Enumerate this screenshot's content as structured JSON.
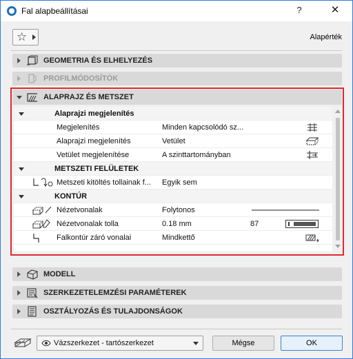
{
  "window": {
    "title": "Fal alapbeállításai",
    "help_label": "?",
    "close_label": "✕"
  },
  "toolbar": {
    "favorites_icon": "star-icon",
    "default_label": "Alapérték"
  },
  "sections": [
    {
      "label": "GEOMETRIA ÉS ELHELYEZÉS",
      "icon": "geometry-icon",
      "enabled": true
    },
    {
      "label": "PROFILMÓDOSÍTÓK",
      "icon": "profile-modifier-icon",
      "enabled": false
    },
    {
      "label": "ALAPRAJZ ÉS METSZET",
      "icon": "floor-plan-section-icon",
      "enabled": true,
      "expanded": true
    },
    {
      "label": "MODELL",
      "icon": "model-icon",
      "enabled": true
    },
    {
      "label": "SZERKEZETELEMZÉSI PARAMÉTEREK",
      "icon": "structural-analysis-icon",
      "enabled": true
    },
    {
      "label": "OSZTÁLYOZÁS ÉS TULAJDONSÁGOK",
      "icon": "classification-icon",
      "enabled": true
    }
  ],
  "groups": {
    "display": "Alaprajzi megjelenítés",
    "cut_surfaces": "METSZETI FELÜLETEK",
    "outlines": "KONTÚR"
  },
  "rows": {
    "show_on_stories": {
      "label": "Megjelenítés",
      "value": "Minden kapcsolódó sz..."
    },
    "floor_plan_display": {
      "label": "Alaprajzi megjelenítés",
      "value": "Vetület"
    },
    "show_projection": {
      "label": "Vetület megjelenítése",
      "value": "A szinttartományban"
    },
    "cut_fill_pens": {
      "label": "Metszeti kitöltés tollainak f...",
      "value": "Egyik sem"
    },
    "uncut_lines": {
      "label": "Nézetvonalak",
      "value": "Folytonos"
    },
    "uncut_line_pen": {
      "label": "Nézetvonalak tolla",
      "value": "0.18 mm",
      "pen_number": "87"
    },
    "outline_close": {
      "label": "Falkontúr záró vonalai",
      "value": "Mindkettő"
    }
  },
  "footer": {
    "layer_value": "Vázszerkezet - tartószerkezet",
    "cancel_label": "Mégse",
    "ok_label": "OK"
  },
  "colors": {
    "highlight_border": "#e0282e",
    "section_bg": "#d9d9d9",
    "ok_border": "#3c7fd4"
  }
}
